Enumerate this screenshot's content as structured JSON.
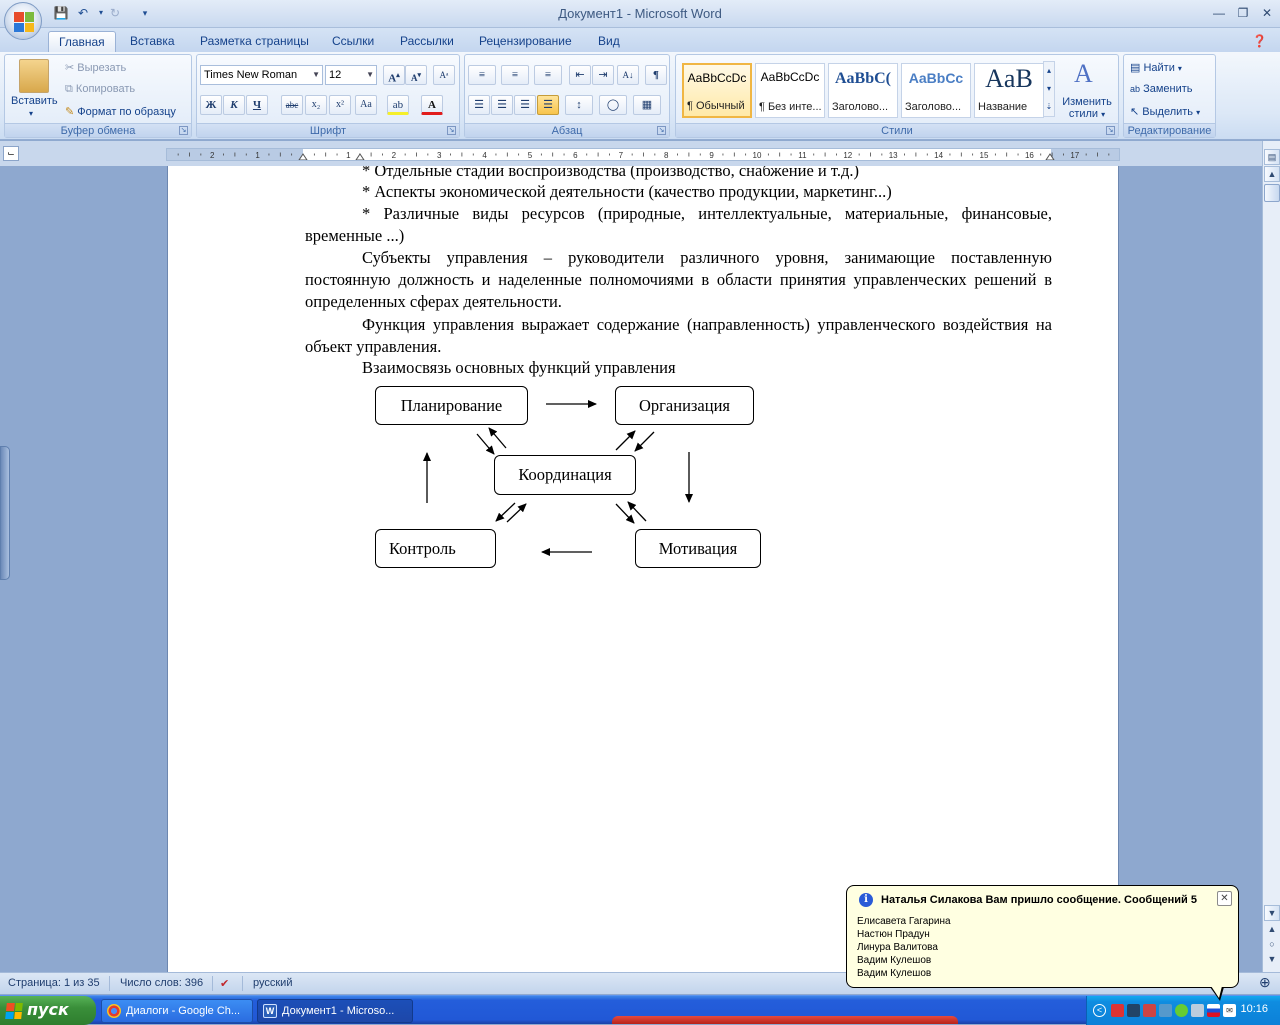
{
  "window": {
    "title": "Документ1 - Microsoft Word"
  },
  "tabs": [
    "Главная",
    "Вставка",
    "Разметка страницы",
    "Ссылки",
    "Рассылки",
    "Рецензирование",
    "Вид"
  ],
  "clipboard": {
    "paste": "Вставить",
    "cut": "Вырезать",
    "copy": "Копировать",
    "format_painter": "Формат по образцу",
    "label": "Буфер обмена"
  },
  "font": {
    "name": "Times New Roman",
    "size": "12",
    "label": "Шрифт"
  },
  "paragraph": {
    "label": "Абзац"
  },
  "styles": {
    "label": "Стили",
    "items": [
      {
        "sample": "AaBbCcDc",
        "name": "¶ Обычный"
      },
      {
        "sample": "AaBbCcDc",
        "name": "¶ Без инте..."
      },
      {
        "sample": "AaBbC(",
        "name": "Заголово..."
      },
      {
        "sample": "AaBbCc",
        "name": "Заголово..."
      },
      {
        "sample": "AaB",
        "name": "Название"
      }
    ],
    "change_label_1": "Изменить",
    "change_label_2": "стили"
  },
  "editing": {
    "find": "Найти",
    "replace": "Заменить",
    "select": "Выделить",
    "label": "Редактирование"
  },
  "document": {
    "paragraphs": [
      "* Отдельные стадии воспроизводства (производство, снабжение и т.д.)",
      "* Аспекты экономической деятельности (качество продукции, маркетинг...)",
      "* Различные виды ресурсов (природные, интеллектуальные, материальные, финансовые, временные ...)",
      "Субъекты управления – руководители различного уровня, занимающие поставленную постоянную должность и наделенные полномочиями в области принятия управленческих решений в определенных сферах деятельности.",
      "Функция управления выражает содержание (направленность) управленческого воздействия на объект управления.",
      "Взаимосвязь основных функций управления"
    ],
    "diagram": {
      "planning": "Планирование",
      "organization": "Организация",
      "coordination": "Координация",
      "control": "Контроль",
      "motivation": "Мотивация"
    }
  },
  "status": {
    "page": "Страница: 1 из 35",
    "words": "Число слов: 396",
    "language": "русский"
  },
  "taskbar": {
    "start": "пуск",
    "tasks": [
      "Диалоги - Google Ch...",
      "Документ1 - Microso..."
    ],
    "clock": "10:16"
  },
  "notification": {
    "title": "Наталья Силакова Вам пришло сообщение. Сообщений 5",
    "names": [
      "Елисавета Гагарина",
      "Настюн Прадун",
      "Линура Валитова",
      "Вадим Кулешов",
      "Вадим Кулешов"
    ]
  },
  "ruler_numbers": [
    "3",
    "2",
    "1",
    "1",
    "2",
    "3",
    "4",
    "5",
    "6",
    "7",
    "8",
    "9",
    "10",
    "11",
    "12",
    "13",
    "14",
    "15",
    "16",
    "17"
  ],
  "colors": {
    "accent": "#15428b",
    "ribbon": "#dce8f7",
    "page_bg": "#8ea8cf",
    "taskbar": "#245edb",
    "start": "#3a8f3a",
    "balloon": "#ffffe1"
  }
}
